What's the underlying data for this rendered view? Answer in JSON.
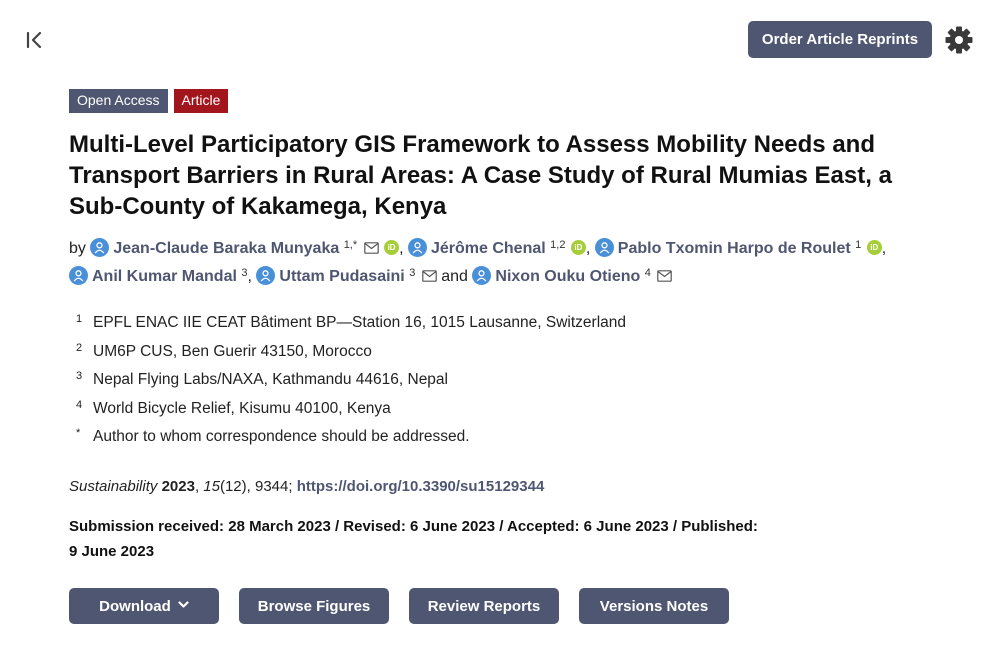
{
  "header": {
    "reprints_label": "Order Article Reprints"
  },
  "badges": {
    "open_access": "Open Access",
    "article_type": "Article"
  },
  "title": "Multi-Level Participatory GIS Framework to Assess Mobility Needs and Transport Barriers in Rural Areas: A Case Study of Rural Mumias East, a Sub-County of Kakamega, Kenya",
  "authors": {
    "prefix": "by",
    "list": [
      {
        "name": "Jean-Claude Baraka Munyaka",
        "aff": "1,*"
      },
      {
        "name": "Jérôme Chenal",
        "aff": "1,2"
      },
      {
        "name": "Pablo Txomin Harpo de Roulet",
        "aff": "1"
      },
      {
        "name": "Anil Kumar Mandal",
        "aff": "3"
      },
      {
        "name": "Uttam Pudasaini",
        "aff": "3"
      },
      {
        "name": "Nixon Ouku Otieno",
        "aff": "4"
      }
    ],
    "sep": ",",
    "conj": "and",
    "orcid_label": "iD"
  },
  "affiliations": [
    {
      "mark": "1",
      "text": "EPFL ENAC IIE CEAT Bâtiment BP—Station 16, 1015 Lausanne, Switzerland"
    },
    {
      "mark": "2",
      "text": "UM6P CUS, Ben Guerir 43150, Morocco"
    },
    {
      "mark": "3",
      "text": "Nepal Flying Labs/NAXA, Kathmandu 44616, Nepal"
    },
    {
      "mark": "4",
      "text": "World Bicycle Relief, Kisumu 40100, Kenya"
    },
    {
      "mark": "*",
      "text": "Author to whom correspondence should be addressed."
    }
  ],
  "citation": {
    "journal": "Sustainability",
    "year": "2023",
    "sep1": ", ",
    "volume": "15",
    "issue_pages": "(12), 9344; ",
    "doi": "https://doi.org/10.3390/su15129344"
  },
  "dates": "Submission received: 28 March 2023 / Revised: 6 June 2023 / Accepted: 6 June 2023 / Published: 9 June 2023",
  "actions": {
    "download": "Download",
    "browse_figures": "Browse Figures",
    "review_reports": "Review Reports",
    "versions_notes": "Versions Notes"
  },
  "colors": {
    "button_bg": "#4f5671",
    "article_badge": "#a3151c",
    "author_link": "#4f5671",
    "orcid": "#a6ce39",
    "avatar": "#4a90d9"
  },
  "icons": [
    "collapse-sidebar-icon",
    "gear-icon",
    "author-avatar-icon",
    "mail-icon",
    "orcid-icon",
    "chevron-down-icon"
  ]
}
